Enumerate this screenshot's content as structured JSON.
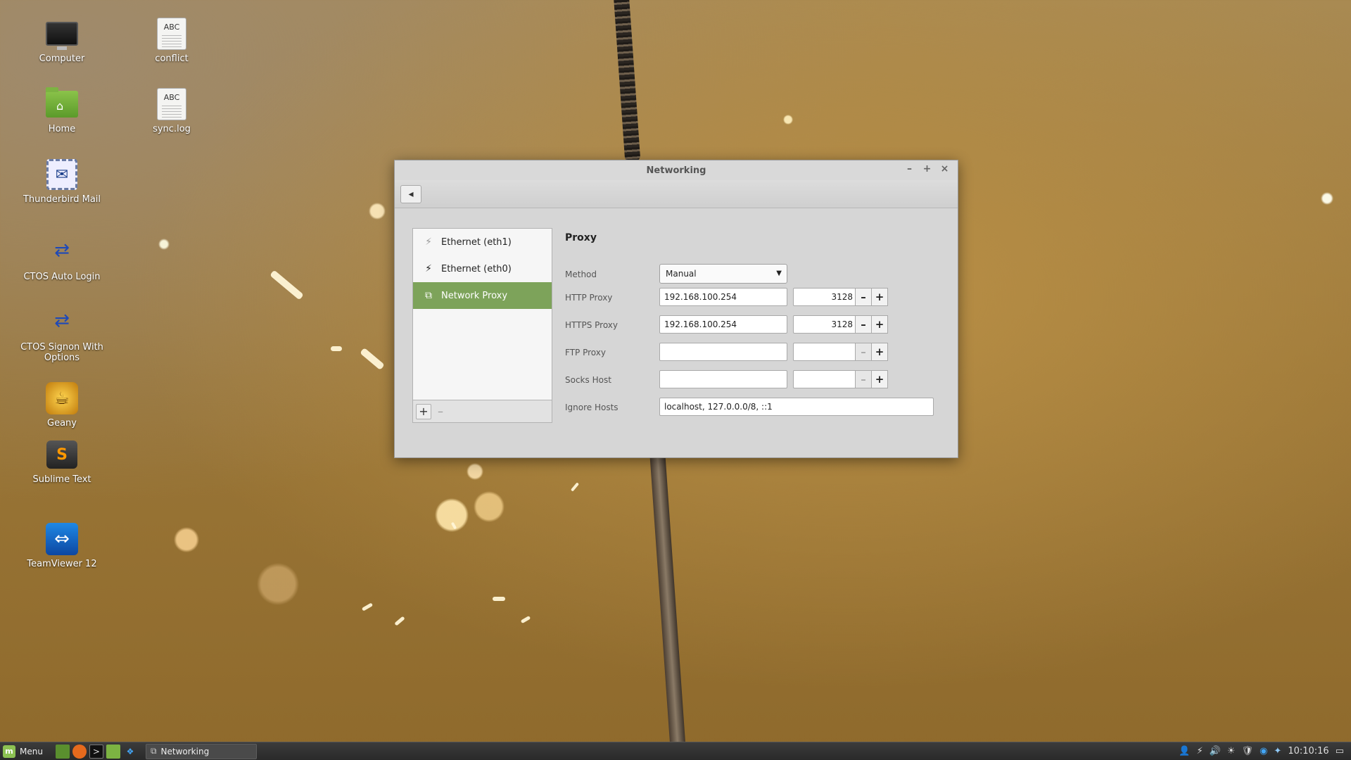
{
  "desktop": {
    "icons": [
      {
        "label": "Computer",
        "icon": "computer-icon"
      },
      {
        "label": "conflict",
        "icon": "text-document-icon",
        "badge": "ABC"
      },
      {
        "label": "Home",
        "icon": "home-folder-icon"
      },
      {
        "label": "sync.log",
        "icon": "text-document-icon",
        "badge": "ABC"
      },
      {
        "label": "Thunderbird Mail",
        "icon": "thunderbird-mail-icon"
      },
      {
        "label": "CTOS Auto Login",
        "icon": "network-connection-icon"
      },
      {
        "label": "CTOS Signon With Options",
        "icon": "network-connection-icon"
      },
      {
        "label": "Geany",
        "icon": "geany-icon"
      },
      {
        "label": "Sublime Text",
        "icon": "sublime-text-icon",
        "glyph": "S"
      },
      {
        "label": "TeamViewer 12",
        "icon": "teamviewer-icon"
      }
    ]
  },
  "window": {
    "title": "Networking",
    "controls": {
      "minimize": "–",
      "maximize": "+",
      "close": "×"
    },
    "back_glyph": "◂",
    "sidebar": {
      "items": [
        {
          "label": "Ethernet (eth1)",
          "icon": "ethernet-disconnected-icon",
          "active": false
        },
        {
          "label": "Ethernet (eth0)",
          "icon": "ethernet-icon",
          "active": false
        },
        {
          "label": "Network Proxy",
          "icon": "network-proxy-icon",
          "active": true
        }
      ],
      "add_glyph": "+",
      "remove_glyph": "–"
    },
    "proxy": {
      "title": "Proxy",
      "method_label": "Method",
      "method_value": "Manual",
      "http_label": "HTTP Proxy",
      "http_host": "192.168.100.254",
      "http_port": "3128",
      "https_label": "HTTPS Proxy",
      "https_host": "192.168.100.254",
      "https_port": "3128",
      "ftp_label": "FTP Proxy",
      "ftp_host": "",
      "ftp_port": "",
      "socks_label": "Socks Host",
      "socks_host": "",
      "socks_port": "",
      "ignore_label": "Ignore Hosts",
      "ignore_value": "localhost, 127.0.0.0/8, ::1",
      "minus_glyph": "–",
      "plus_glyph": "+"
    }
  },
  "panel": {
    "menu_label": "Menu",
    "task_label": "Networking",
    "clock": "10:10:16",
    "colors": {
      "accent": "#7da35a",
      "panel": "#2f2f2f"
    }
  }
}
